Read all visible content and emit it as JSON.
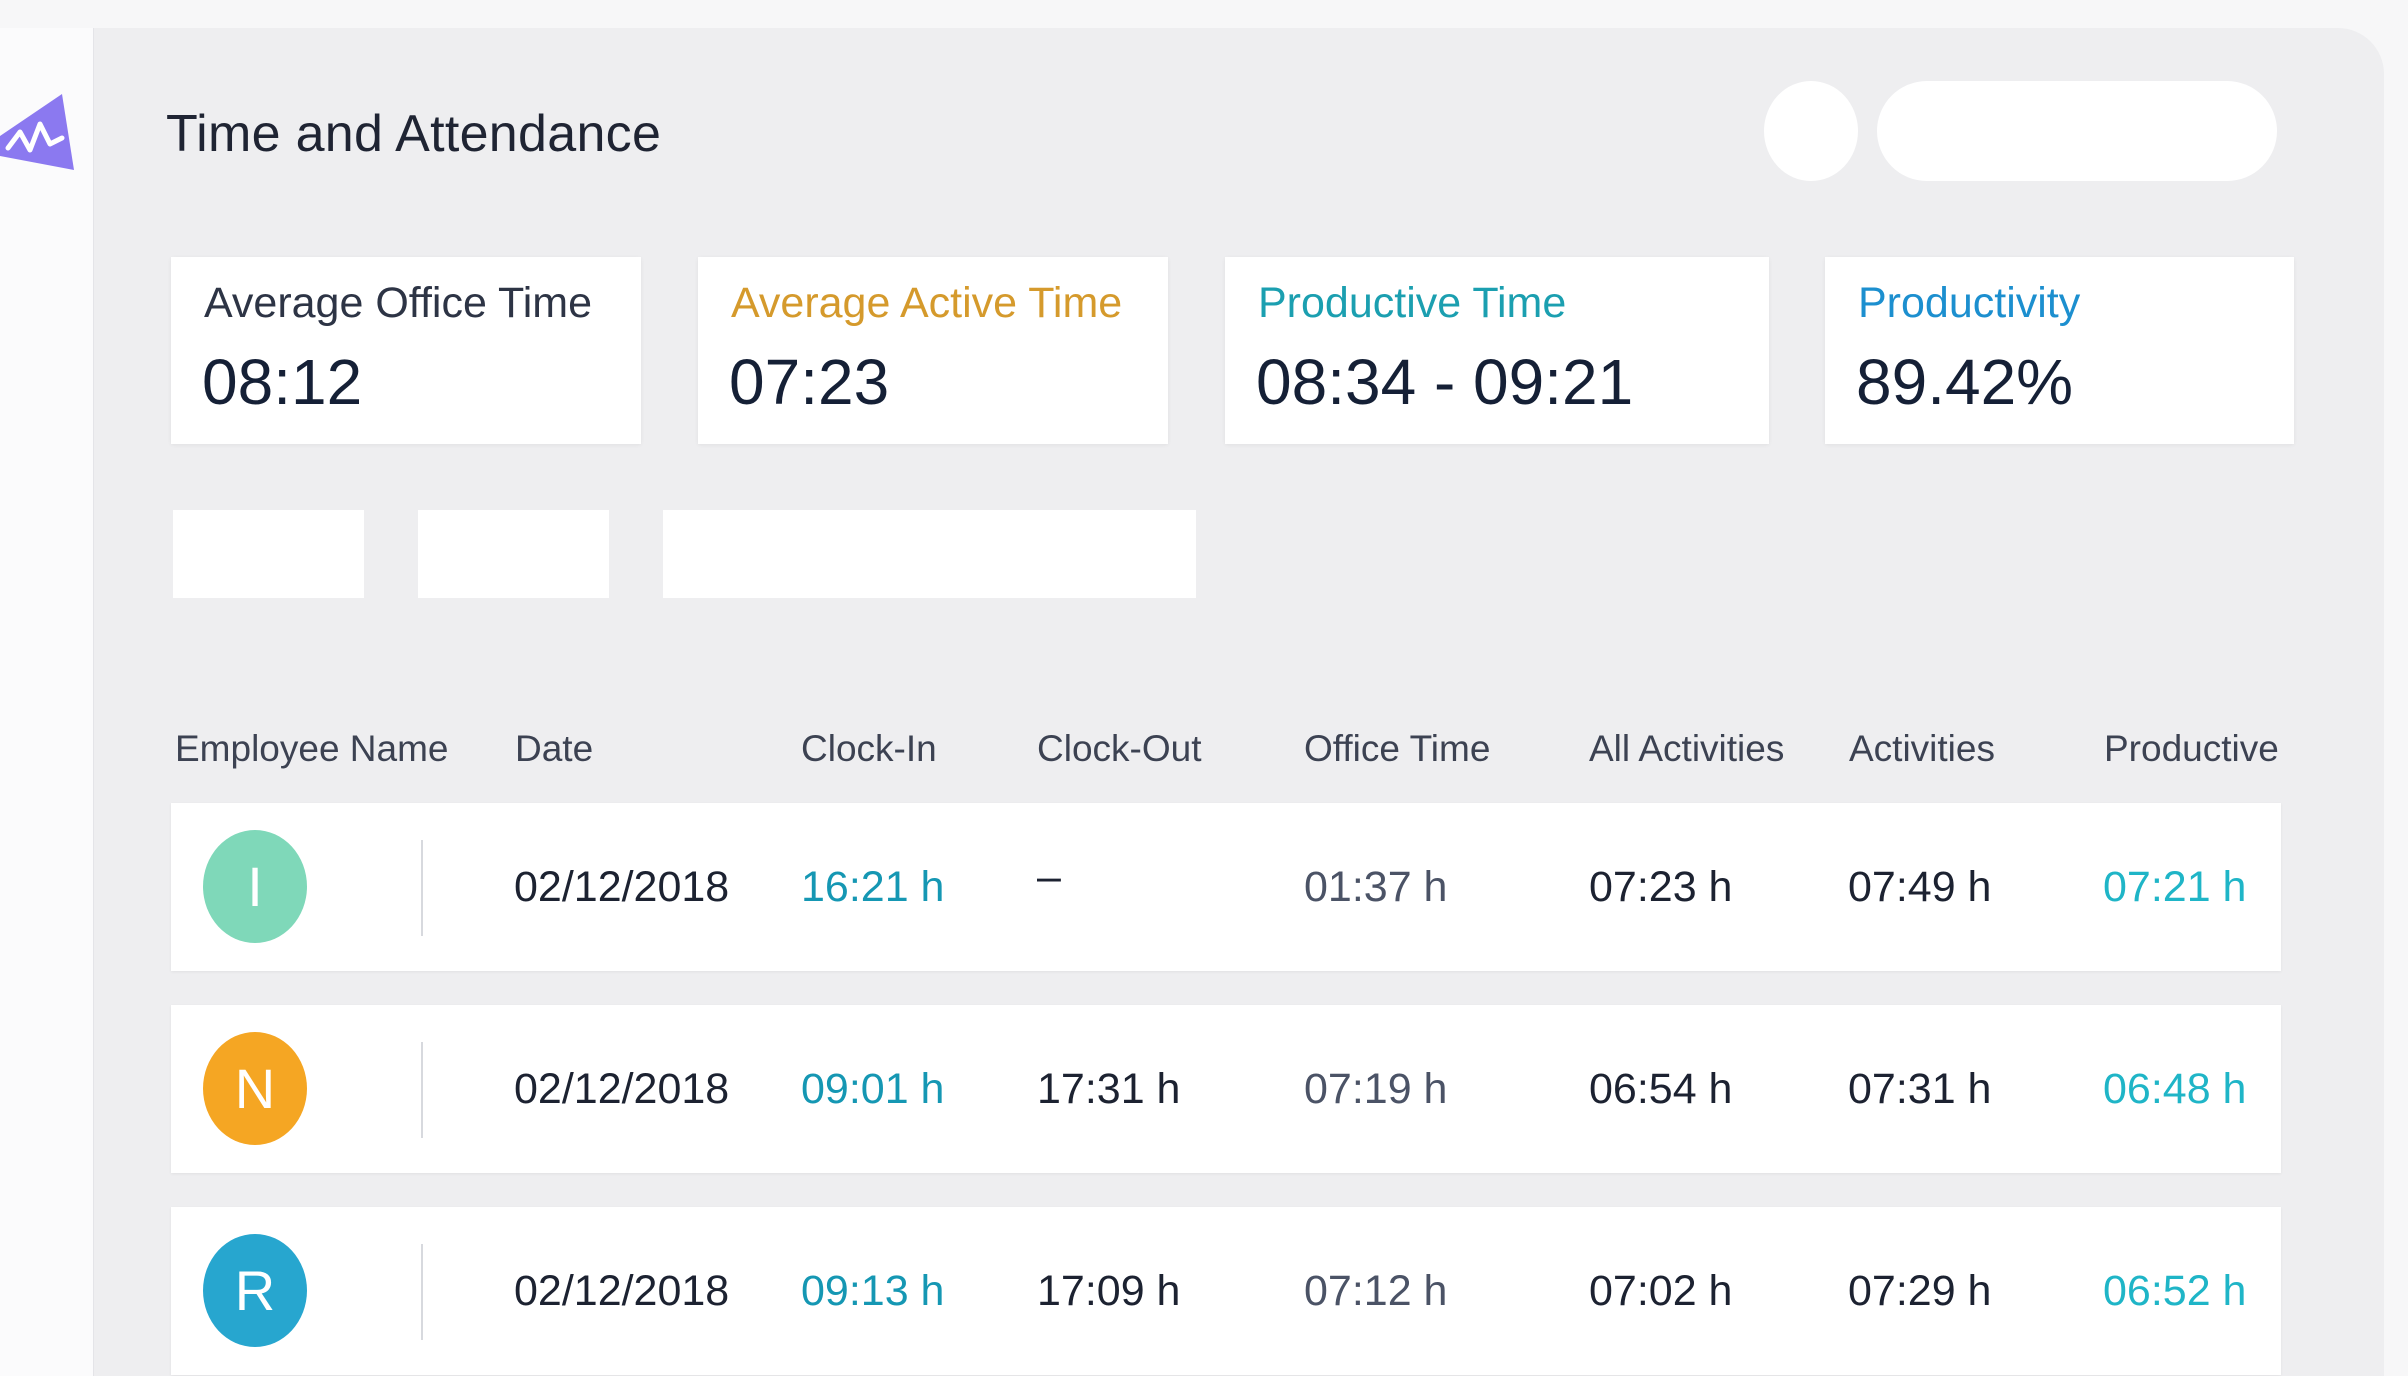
{
  "header": {
    "title": "Time and Attendance"
  },
  "stats": [
    {
      "label": "Average Office Time",
      "value": "08:12",
      "label_color": "#2d3445"
    },
    {
      "label": "Average Active Time",
      "value": "07:23",
      "label_color": "#d59a2c"
    },
    {
      "label": "Productive Time",
      "value": "08:34 - 09:21",
      "label_color": "#1b9fb0"
    },
    {
      "label": "Productivity",
      "value": "89.42%",
      "label_color": "#1c8fcf"
    }
  ],
  "table": {
    "columns": [
      "Employee Name",
      "Date",
      "Clock-In",
      "Clock-Out",
      "Office Time",
      "All Activities",
      "Activities",
      "Productive"
    ],
    "rows": [
      {
        "initial": "I",
        "avatar_color": "#7fd8b9",
        "date": "02/12/2018",
        "clock_in": "16:21 h",
        "clock_out": "–",
        "office_time": "01:37 h",
        "all_activities": "07:23 h",
        "activities": "07:49 h",
        "productive": "07:21 h"
      },
      {
        "initial": "N",
        "avatar_color": "#f5a623",
        "date": "02/12/2018",
        "clock_in": "09:01 h",
        "clock_out": "17:31 h",
        "office_time": "07:19 h",
        "all_activities": "06:54 h",
        "activities": "07:31 h",
        "productive": "06:48 h"
      },
      {
        "initial": "R",
        "avatar_color": "#27a6cf",
        "date": "02/12/2018",
        "clock_in": "09:13 h",
        "clock_out": "17:09 h",
        "office_time": "07:12 h",
        "all_activities": "07:02 h",
        "activities": "07:29 h",
        "productive": "06:52 h"
      }
    ]
  },
  "colors": {
    "brand": "#8b79f0",
    "clock_in": "#1597b3",
    "productive": "#1fb5c7"
  },
  "icons": {
    "logo": "pulse-logo-icon"
  }
}
